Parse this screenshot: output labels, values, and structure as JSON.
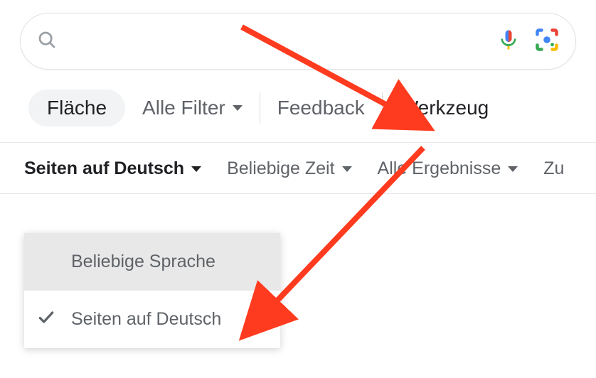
{
  "search": {
    "placeholder": ""
  },
  "toolbar": {
    "pill_label": "Fläche",
    "all_filters_label": "Alle Filter",
    "feedback_label": "Feedback",
    "tools_label": "Werkzeug"
  },
  "subbar": {
    "language_filter_label": "Seiten auf Deutsch",
    "time_filter_label": "Beliebige Zeit",
    "results_filter_label": "Alle Ergebnisse",
    "reset_label": "Zu"
  },
  "dropdown": {
    "any_language_label": "Beliebige Sprache",
    "selected_label": "Seiten auf Deutsch"
  }
}
